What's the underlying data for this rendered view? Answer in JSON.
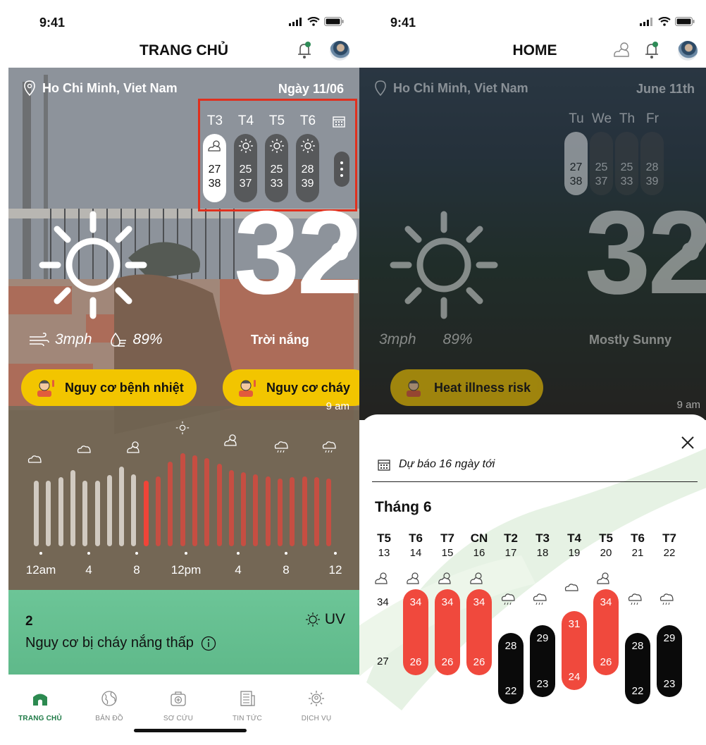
{
  "left": {
    "status_time": "9:41",
    "title": "TRANG CHỦ",
    "location": "Ho Chi Minh, Viet Nam",
    "date": "Ngày 11/06",
    "days": [
      {
        "day": "T3",
        "icon": "partly-cloudy-icon",
        "high": "27",
        "low": "38",
        "active": true
      },
      {
        "day": "T4",
        "icon": "sun-icon",
        "high": "25",
        "low": "37",
        "active": false
      },
      {
        "day": "T5",
        "icon": "sun-icon",
        "high": "25",
        "low": "33",
        "active": false
      },
      {
        "day": "T6",
        "icon": "sun-icon",
        "high": "28",
        "low": "39",
        "active": false
      }
    ],
    "temperature": "32",
    "degree_symbol": "o",
    "condition": "Trời nắng",
    "wind": "3mph",
    "humidity": "89%",
    "risk_1": "Nguy cơ bệnh nhiệt",
    "risk_2": "Nguy cơ cháy",
    "next_label": "9 am",
    "hourly_ticks": [
      "12am",
      "4",
      "8",
      "12pm",
      "4",
      "8",
      "12"
    ],
    "hourly_levels": [
      0.62,
      0.62,
      0.65,
      0.72,
      0.62,
      0.62,
      0.67,
      0.75,
      0.68,
      0.62,
      0.66,
      0.8,
      0.88,
      0.86,
      0.83,
      0.78,
      0.72,
      0.7,
      0.68,
      0.66,
      0.64,
      0.65,
      0.66,
      0.65,
      0.64
    ],
    "uv_value": "2",
    "uv_label": "UV",
    "uv_desc": "Nguy cơ bị cháy nắng thấp",
    "tabs": [
      {
        "label": "TRANG CHỦ",
        "icon": "home-icon",
        "active": true
      },
      {
        "label": "BẢN ĐỒ",
        "icon": "globe-icon",
        "active": false
      },
      {
        "label": "SƠ CỨU",
        "icon": "first-aid-icon",
        "active": false
      },
      {
        "label": "TIN TỨC",
        "icon": "news-icon",
        "active": false
      },
      {
        "label": "DỊCH VỤ",
        "icon": "service-icon",
        "active": false
      }
    ]
  },
  "right": {
    "status_time": "9:41",
    "title": "HOME",
    "location": "Ho Chi Minh, Viet Nam",
    "date": "June 11th",
    "days": [
      {
        "day": "Tu",
        "icon": "partly-cloudy-icon",
        "high": "27",
        "low": "38",
        "active": true
      },
      {
        "day": "We",
        "icon": "sun-icon",
        "high": "25",
        "low": "37",
        "active": false
      },
      {
        "day": "Th",
        "icon": "sun-icon",
        "high": "25",
        "low": "33",
        "active": false
      },
      {
        "day": "Fr",
        "icon": "sun-icon",
        "high": "28",
        "low": "39",
        "active": false
      }
    ],
    "temperature": "32",
    "degree_symbol": "o",
    "condition": "Mostly Sunny",
    "wind": "3mph",
    "humidity": "89%",
    "risk_1": "Heat illness risk",
    "next_label": "9 am",
    "sheet": {
      "subtitle": "Dự báo 16 ngày tới",
      "month": "Tháng 6",
      "left_high": "34",
      "left_low": "27",
      "days": [
        {
          "name": "T5",
          "date": "13",
          "icon": "partly-cloudy-icon"
        },
        {
          "name": "T6",
          "date": "14",
          "icon": "partly-cloudy-icon",
          "high": "34",
          "low": "26",
          "color": "red"
        },
        {
          "name": "T7",
          "date": "15",
          "icon": "partly-cloudy-icon",
          "high": "34",
          "low": "26",
          "color": "red"
        },
        {
          "name": "CN",
          "date": "16",
          "icon": "partly-cloudy-icon",
          "high": "34",
          "low": "26",
          "color": "red"
        },
        {
          "name": "T2",
          "date": "17",
          "icon": "rain-icon",
          "high": "28",
          "low": "22",
          "color": "black"
        },
        {
          "name": "T3",
          "date": "18",
          "icon": "rain-icon",
          "high": "29",
          "low": "23",
          "color": "black"
        },
        {
          "name": "T4",
          "date": "19",
          "icon": "cloud-icon",
          "high": "31",
          "low": "24",
          "color": "red"
        },
        {
          "name": "T5",
          "date": "20",
          "icon": "partly-cloudy-icon",
          "high": "34",
          "low": "26",
          "color": "red"
        },
        {
          "name": "T6",
          "date": "21",
          "icon": "rain-icon",
          "high": "28",
          "low": "22",
          "color": "black"
        },
        {
          "name": "T7",
          "date": "22",
          "icon": "rain-icon",
          "high": "29",
          "low": "23",
          "color": "black"
        }
      ]
    }
  },
  "colors": {
    "risk": "#f2c500",
    "red": "#f0493d",
    "green": "#5fb98a",
    "accent": "#1e7a46"
  }
}
